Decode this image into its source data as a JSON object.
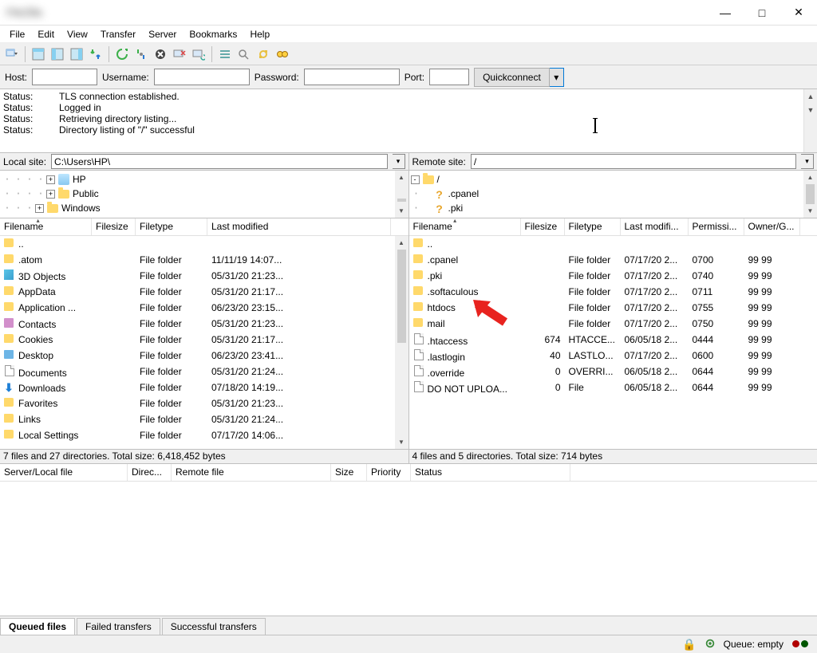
{
  "window": {
    "title": "FileZilla"
  },
  "menu": [
    "File",
    "Edit",
    "View",
    "Transfer",
    "Server",
    "Bookmarks",
    "Help"
  ],
  "quickconnect": {
    "host_label": "Host:",
    "user_label": "Username:",
    "pass_label": "Password:",
    "port_label": "Port:",
    "host": "",
    "user": "",
    "pass": "",
    "port": "",
    "button": "Quickconnect"
  },
  "log": [
    {
      "label": "Status:",
      "msg": "TLS connection established."
    },
    {
      "label": "Status:",
      "msg": "Logged in"
    },
    {
      "label": "Status:",
      "msg": "Retrieving directory listing..."
    },
    {
      "label": "Status:",
      "msg": "Directory listing of \"/\" successful"
    }
  ],
  "local_site_label": "Local site:",
  "local_site_path": "C:\\Users\\HP\\",
  "remote_site_label": "Remote site:",
  "remote_site_path": "/",
  "local_tree": [
    {
      "indent": 4,
      "expand": "+",
      "icon": "avatar",
      "name": "HP"
    },
    {
      "indent": 4,
      "expand": "+",
      "icon": "folder",
      "name": "Public"
    },
    {
      "indent": 3,
      "expand": "+",
      "icon": "folder",
      "name": "Windows"
    }
  ],
  "remote_tree": [
    {
      "indent": 0,
      "expand": "-",
      "icon": "folder",
      "name": "/"
    },
    {
      "indent": 1,
      "expand": "",
      "icon": "q",
      "name": ".cpanel"
    },
    {
      "indent": 1,
      "expand": "",
      "icon": "q",
      "name": ".pki"
    }
  ],
  "local_headers": [
    "Filename",
    "Filesize",
    "Filetype",
    "Last modified"
  ],
  "local_col_w": [
    115,
    55,
    90,
    230
  ],
  "local_files": [
    {
      "icon": "folder",
      "name": "..",
      "size": "",
      "type": "",
      "mod": ""
    },
    {
      "icon": "folder",
      "name": ".atom",
      "size": "",
      "type": "File folder",
      "mod": "11/11/19 14:07..."
    },
    {
      "icon": "box3d",
      "name": "3D Objects",
      "size": "",
      "type": "File folder",
      "mod": "05/31/20 21:23..."
    },
    {
      "icon": "folder",
      "name": "AppData",
      "size": "",
      "type": "File folder",
      "mod": "05/31/20 21:17..."
    },
    {
      "icon": "folder",
      "name": "Application ...",
      "size": "",
      "type": "File folder",
      "mod": "06/23/20 23:15..."
    },
    {
      "icon": "contacts",
      "name": "Contacts",
      "size": "",
      "type": "File folder",
      "mod": "05/31/20 21:23..."
    },
    {
      "icon": "folder",
      "name": "Cookies",
      "size": "",
      "type": "File folder",
      "mod": "05/31/20 21:17..."
    },
    {
      "icon": "disk",
      "name": "Desktop",
      "size": "",
      "type": "File folder",
      "mod": "06/23/20 23:41..."
    },
    {
      "icon": "file",
      "name": "Documents",
      "size": "",
      "type": "File folder",
      "mod": "05/31/20 21:24..."
    },
    {
      "icon": "download",
      "name": "Downloads",
      "size": "",
      "type": "File folder",
      "mod": "07/18/20 14:19..."
    },
    {
      "icon": "folder",
      "name": "Favorites",
      "size": "",
      "type": "File folder",
      "mod": "05/31/20 21:23..."
    },
    {
      "icon": "folder",
      "name": "Links",
      "size": "",
      "type": "File folder",
      "mod": "05/31/20 21:24..."
    },
    {
      "icon": "folder",
      "name": "Local Settings",
      "size": "",
      "type": "File folder",
      "mod": "07/17/20 14:06..."
    }
  ],
  "remote_headers": [
    "Filename",
    "Filesize",
    "Filetype",
    "Last modifi...",
    "Permissi...",
    "Owner/G..."
  ],
  "remote_col_w": [
    140,
    55,
    70,
    85,
    70,
    70
  ],
  "remote_files": [
    {
      "icon": "folder",
      "name": "..",
      "size": "",
      "type": "",
      "mod": "",
      "perm": "",
      "own": ""
    },
    {
      "icon": "folder",
      "name": ".cpanel",
      "size": "",
      "type": "File folder",
      "mod": "07/17/20 2...",
      "perm": "0700",
      "own": "99 99"
    },
    {
      "icon": "folder",
      "name": ".pki",
      "size": "",
      "type": "File folder",
      "mod": "07/17/20 2...",
      "perm": "0740",
      "own": "99 99"
    },
    {
      "icon": "folder",
      "name": ".softaculous",
      "size": "",
      "type": "File folder",
      "mod": "07/17/20 2...",
      "perm": "0711",
      "own": "99 99"
    },
    {
      "icon": "folder",
      "name": "htdocs",
      "size": "",
      "type": "File folder",
      "mod": "07/17/20 2...",
      "perm": "0755",
      "own": "99 99"
    },
    {
      "icon": "folder",
      "name": "mail",
      "size": "",
      "type": "File folder",
      "mod": "07/17/20 2...",
      "perm": "0750",
      "own": "99 99"
    },
    {
      "icon": "file",
      "name": ".htaccess",
      "size": "674",
      "type": "HTACCE...",
      "mod": "06/05/18 2...",
      "perm": "0444",
      "own": "99 99"
    },
    {
      "icon": "file",
      "name": ".lastlogin",
      "size": "40",
      "type": "LASTLO...",
      "mod": "07/17/20 2...",
      "perm": "0600",
      "own": "99 99"
    },
    {
      "icon": "file",
      "name": ".override",
      "size": "0",
      "type": "OVERRI...",
      "mod": "06/05/18 2...",
      "perm": "0644",
      "own": "99 99"
    },
    {
      "icon": "file",
      "name": "DO NOT UPLOA...",
      "size": "0",
      "type": "File",
      "mod": "06/05/18 2...",
      "perm": "0644",
      "own": "99 99"
    }
  ],
  "local_summary": "7 files and 27 directories. Total size: 6,418,452 bytes",
  "remote_summary": "4 files and 5 directories. Total size: 714 bytes",
  "queue_headers": [
    "Server/Local file",
    "Direc...",
    "Remote file",
    "Size",
    "Priority",
    "Status"
  ],
  "queue_col_w": [
    160,
    55,
    200,
    45,
    55,
    200
  ],
  "tabs": [
    {
      "label": "Queued files",
      "active": true
    },
    {
      "label": "Failed transfers",
      "active": false
    },
    {
      "label": "Successful transfers",
      "active": false
    }
  ],
  "status_queue": "Queue: empty"
}
